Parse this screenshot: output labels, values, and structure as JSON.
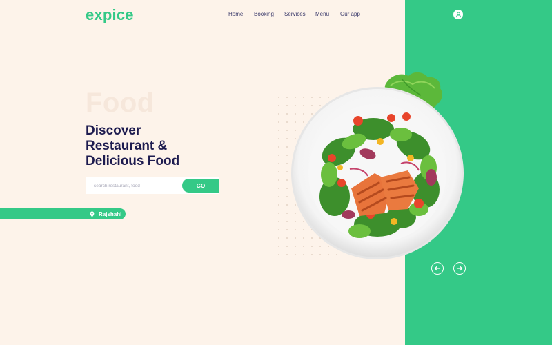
{
  "brand": {
    "logo": "expice"
  },
  "nav": {
    "items": [
      "Home",
      "Booking",
      "Services",
      "Menu",
      "Our app"
    ]
  },
  "hero": {
    "background_word": "Food",
    "headline_line1": "Discover",
    "headline_line2": "Restaurant &",
    "headline_line3": "Delicious Food"
  },
  "search": {
    "placeholder": "search restaurant, food",
    "button_label": "GO"
  },
  "location": {
    "label": "Rajshahi"
  },
  "colors": {
    "accent": "#34c987",
    "background": "#fdf3ea",
    "text": "#1d1b4f"
  },
  "icons": {
    "user": "user-icon",
    "location": "map-pin-icon",
    "prev": "arrow-left-icon",
    "next": "arrow-right-icon"
  }
}
